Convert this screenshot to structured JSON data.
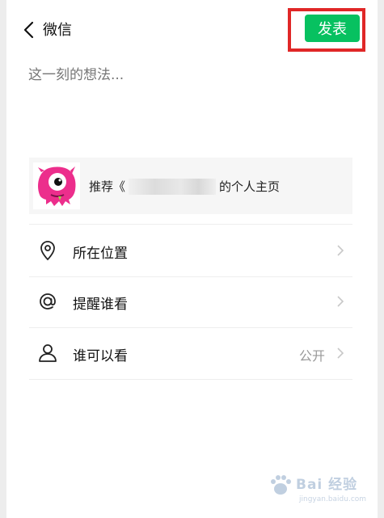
{
  "header": {
    "title": "微信",
    "publish_label": "发表"
  },
  "composer": {
    "placeholder": "这一刻的想法..."
  },
  "share_card": {
    "prefix": "推荐《",
    "suffix": "的个人主页"
  },
  "options": [
    {
      "label": "所在位置",
      "value": "",
      "icon": "location-pin-icon"
    },
    {
      "label": "提醒谁看",
      "value": "",
      "icon": "at-sign-icon"
    },
    {
      "label": "谁可以看",
      "value": "公开",
      "icon": "person-icon"
    }
  ],
  "watermark": {
    "brand": "Bai 经验",
    "url": "jingyan.baidu.com"
  },
  "colors": {
    "accent": "#07c160",
    "highlight": "#e02727",
    "card_bg": "#f6f6f6",
    "thumb_pink": "#ec2e8c"
  }
}
